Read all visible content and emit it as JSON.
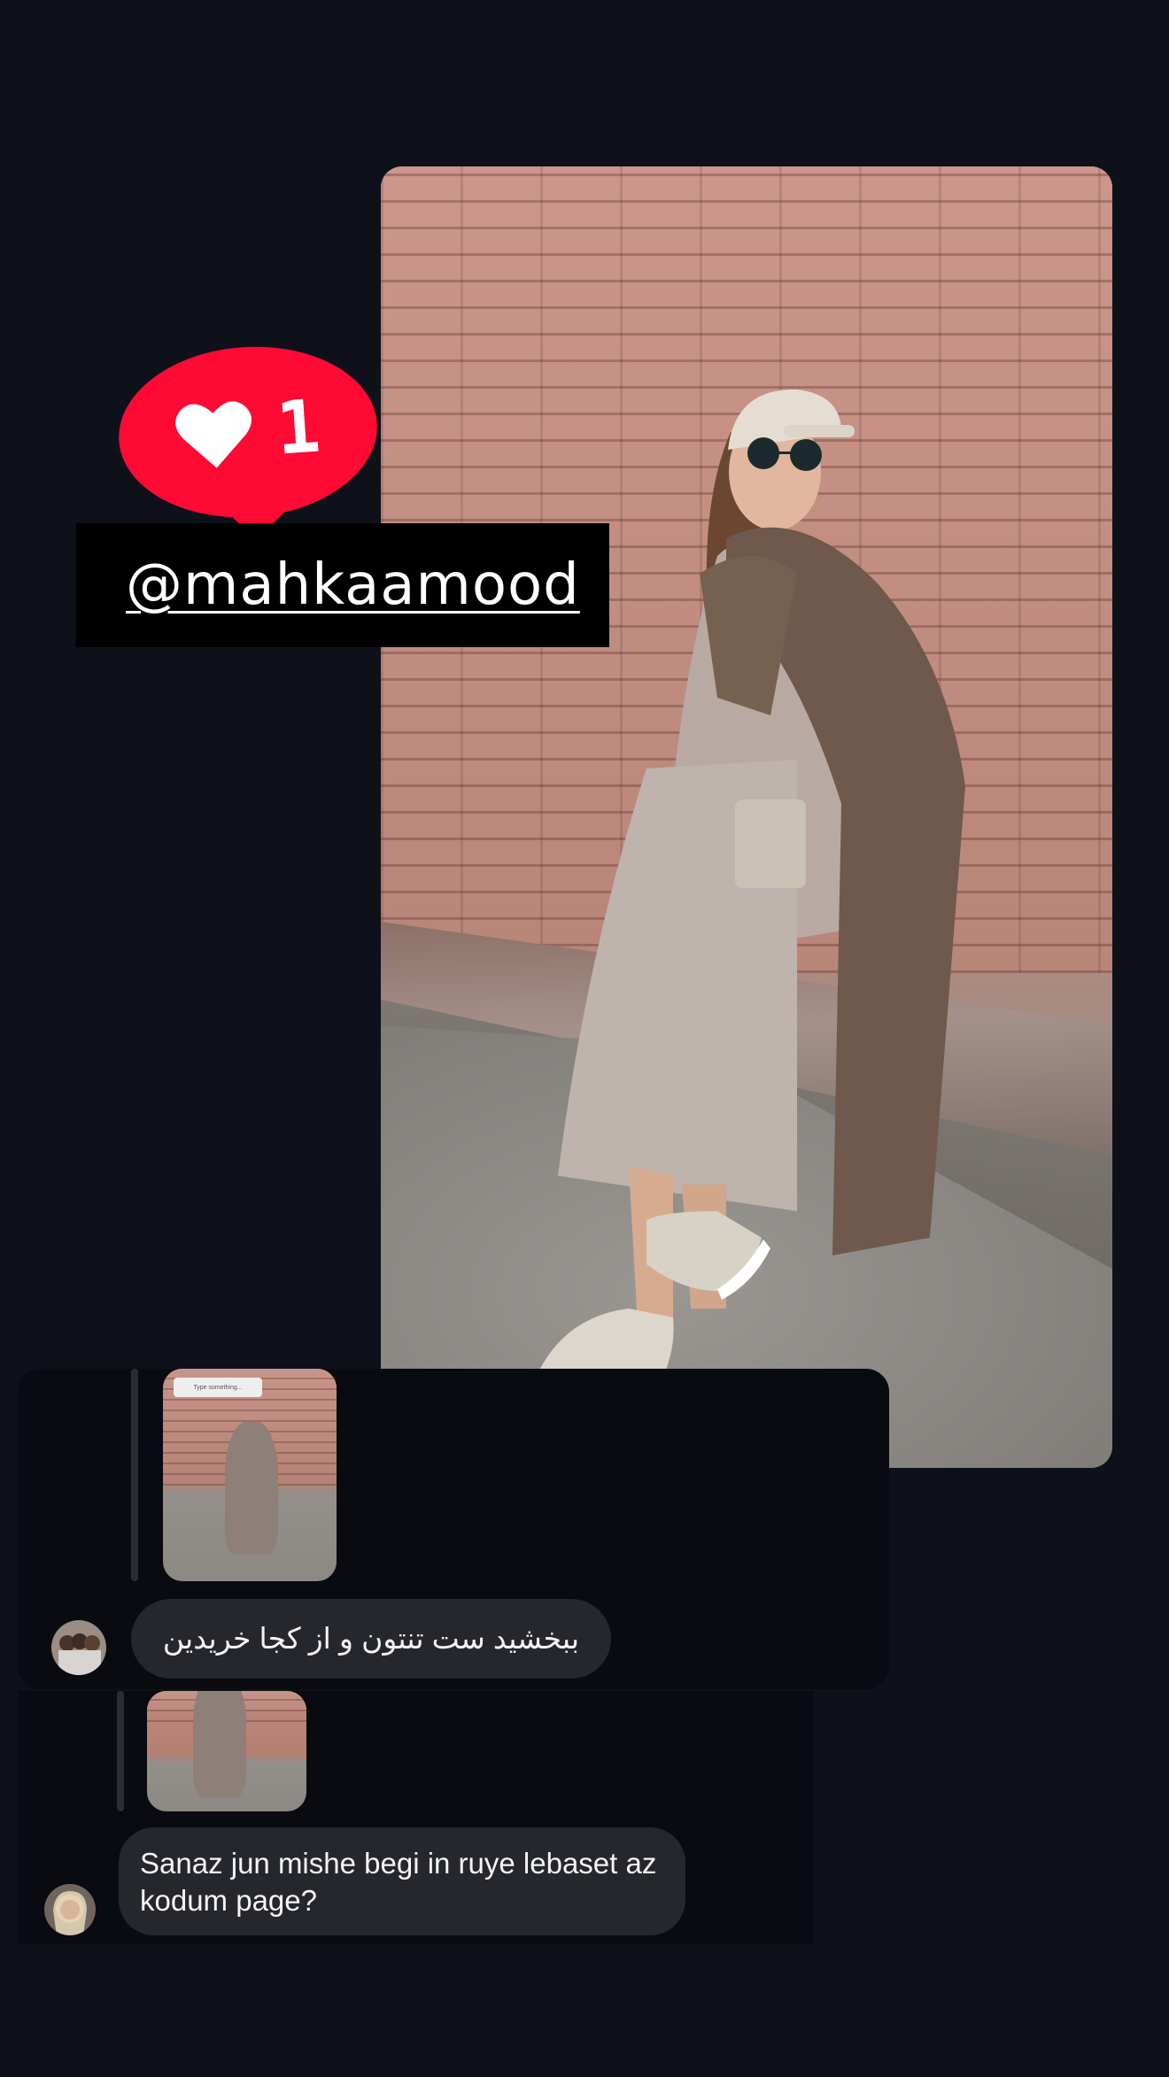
{
  "story": {
    "like_sticker": {
      "icon": "heart-icon",
      "count": "1",
      "color": "#ff0a35"
    },
    "mention_tag": {
      "handle": "@mahkaamood"
    }
  },
  "dm_thread": {
    "messages": [
      {
        "reply_preview": {
          "label": "Type something..."
        },
        "avatar": "avatar-group-photo",
        "text": "ببخشید ست تنتون و از کجا خریدین"
      },
      {
        "avatar": "avatar-profile-photo",
        "text": "Sanaz jun mishe begi in ruye lebaset az kodum page?"
      }
    ]
  },
  "colors": {
    "background": "#0e111a",
    "panel": "#090b10",
    "bubble": "#25272d",
    "bubble_text": "#f4f4f6"
  }
}
